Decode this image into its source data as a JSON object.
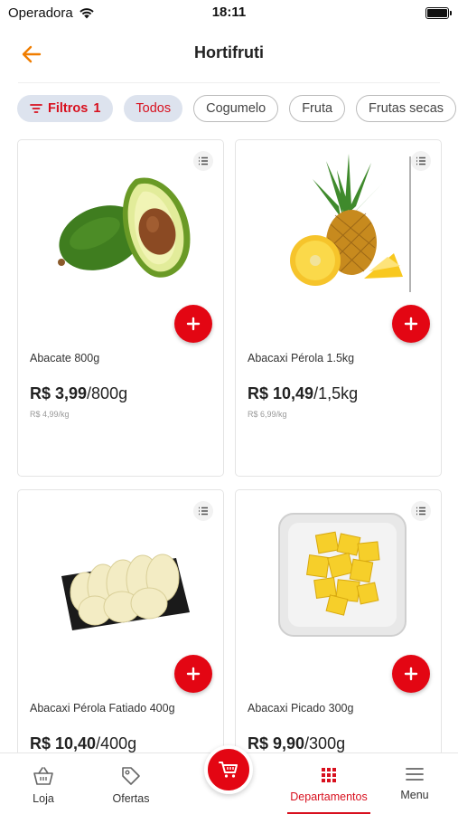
{
  "status_bar": {
    "carrier": "Operadora",
    "time": "18:11"
  },
  "header": {
    "title": "Hortifruti"
  },
  "chips": {
    "filter_label": "Filtros",
    "filter_count": "1",
    "items": [
      "Todos",
      "Cogumelo",
      "Fruta",
      "Frutas secas"
    ]
  },
  "products": [
    {
      "name": "Abacate 800g",
      "price": "R$ 3,99",
      "per": "/800g",
      "unit_price": "R$ 4,99/kg"
    },
    {
      "name": "Abacaxi Pérola 1.5kg",
      "price": "R$ 10,49",
      "per": "/1,5kg",
      "unit_price": "R$ 6,99/kg"
    },
    {
      "name": "Abacaxi Pérola Fatiado 400g",
      "price": "R$ 10,40",
      "per": "/400g",
      "unit_price": ""
    },
    {
      "name": "Abacaxi Picado 300g",
      "price": "R$ 9,90",
      "per": "/300g",
      "unit_price": ""
    }
  ],
  "bottom_nav": {
    "items": [
      {
        "label": "Loja",
        "icon": "basket-icon"
      },
      {
        "label": "Ofertas",
        "icon": "tag-icon"
      },
      {
        "label": "Departamentos",
        "icon": "grid-icon",
        "active": true
      },
      {
        "label": "Menu",
        "icon": "hamburger-icon"
      }
    ],
    "cart_icon": "cart-icon"
  },
  "colors": {
    "accent": "#e30613",
    "chip_bg": "#dde3ee",
    "back_arrow": "#f07d00"
  }
}
